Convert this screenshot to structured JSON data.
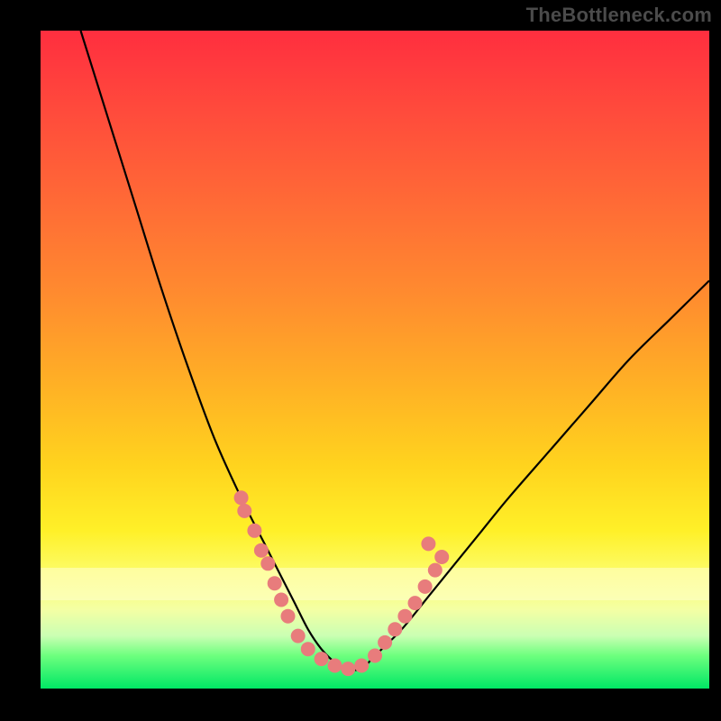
{
  "watermark": "TheBottleneck.com",
  "colors": {
    "bg_black": "#000000",
    "grad_top": "#ff2e3f",
    "grad_bottom": "#00e765",
    "dot": "#e87c7c",
    "curve": "#000000"
  },
  "chart_data": {
    "type": "line",
    "title": "",
    "xlabel": "",
    "ylabel": "",
    "xlim": [
      0,
      100
    ],
    "ylim": [
      0,
      100
    ],
    "note": "Axes unlabeled; values are normalized 0–100. Lower values (toward green) are better. V-shaped bottleneck curve with minimum near x≈42–48.",
    "series": [
      {
        "name": "bottleneck-curve",
        "x": [
          6,
          10,
          14,
          18,
          22,
          26,
          30,
          34,
          36,
          38,
          40,
          42,
          44,
          46,
          48,
          50,
          54,
          58,
          62,
          66,
          70,
          76,
          82,
          88,
          94,
          100
        ],
        "y": [
          100,
          87,
          74,
          61,
          49,
          38,
          29,
          21,
          17,
          13,
          9,
          6,
          4,
          3,
          3,
          5,
          9,
          14,
          19,
          24,
          29,
          36,
          43,
          50,
          56,
          62
        ]
      }
    ],
    "markers": {
      "name": "highlight-dots",
      "note": "Pale red dots clustered near the bottom of the V on both branches.",
      "points": [
        {
          "x": 30,
          "y": 29
        },
        {
          "x": 30.5,
          "y": 27
        },
        {
          "x": 32,
          "y": 24
        },
        {
          "x": 33,
          "y": 21
        },
        {
          "x": 34,
          "y": 19
        },
        {
          "x": 35,
          "y": 16
        },
        {
          "x": 36,
          "y": 13.5
        },
        {
          "x": 37,
          "y": 11
        },
        {
          "x": 38.5,
          "y": 8
        },
        {
          "x": 40,
          "y": 6
        },
        {
          "x": 42,
          "y": 4.5
        },
        {
          "x": 44,
          "y": 3.5
        },
        {
          "x": 46,
          "y": 3
        },
        {
          "x": 48,
          "y": 3.5
        },
        {
          "x": 50,
          "y": 5
        },
        {
          "x": 51.5,
          "y": 7
        },
        {
          "x": 53,
          "y": 9
        },
        {
          "x": 54.5,
          "y": 11
        },
        {
          "x": 56,
          "y": 13
        },
        {
          "x": 57.5,
          "y": 15.5
        },
        {
          "x": 59,
          "y": 18
        },
        {
          "x": 58,
          "y": 22
        },
        {
          "x": 60,
          "y": 20
        }
      ]
    }
  }
}
